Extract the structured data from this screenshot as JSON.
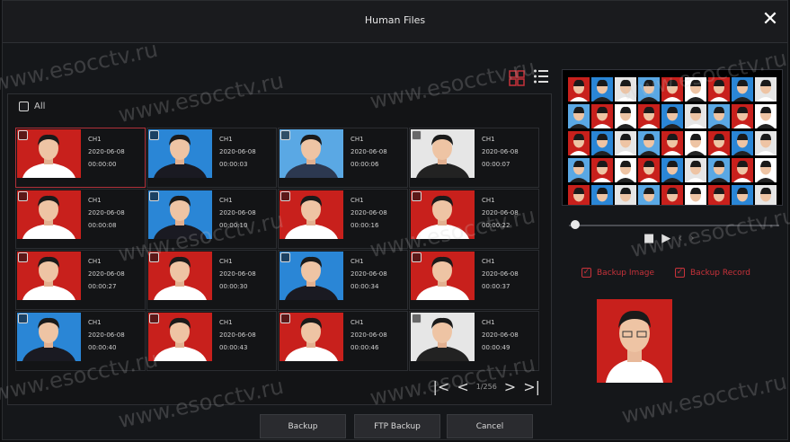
{
  "window": {
    "title": "Human Files",
    "close_label": "✕"
  },
  "select_all": {
    "label": "All",
    "checked": false
  },
  "files": [
    {
      "channel": "CH1",
      "date": "2020-06-08",
      "time": "00:00:00",
      "bg": "#c8201c",
      "shirt": "#ffffff",
      "selected": true
    },
    {
      "channel": "CH1",
      "date": "2020-06-08",
      "time": "00:00:03",
      "bg": "#2a86d6",
      "shirt": "#1a1a22",
      "selected": false
    },
    {
      "channel": "CH1",
      "date": "2020-06-08",
      "time": "00:00:06",
      "bg": "#5aa8e4",
      "shirt": "#2c3850",
      "selected": false
    },
    {
      "channel": "CH1",
      "date": "2020-06-08",
      "time": "00:00:07",
      "bg": "#e6e6e6",
      "shirt": "#222222",
      "selected": false
    },
    {
      "channel": "CH1",
      "date": "2020-06-08",
      "time": "00:00:08",
      "bg": "#c8201c",
      "shirt": "#ffffff",
      "selected": false
    },
    {
      "channel": "CH1",
      "date": "2020-06-08",
      "time": "00:00:10",
      "bg": "#2a86d6",
      "shirt": "#1a1a22",
      "selected": false
    },
    {
      "channel": "CH1",
      "date": "2020-06-08",
      "time": "00:00:16",
      "bg": "#c8201c",
      "shirt": "#ffffff",
      "selected": false
    },
    {
      "channel": "CH1",
      "date": "2020-06-08",
      "time": "00:00:22",
      "bg": "#c8201c",
      "shirt": "#ffffff",
      "selected": false
    },
    {
      "channel": "CH1",
      "date": "2020-06-08",
      "time": "00:00:27",
      "bg": "#c8201c",
      "shirt": "#ffffff",
      "selected": false
    },
    {
      "channel": "CH1",
      "date": "2020-06-08",
      "time": "00:00:30",
      "bg": "#c8201c",
      "shirt": "#ffffff",
      "selected": false
    },
    {
      "channel": "CH1",
      "date": "2020-06-08",
      "time": "00:00:34",
      "bg": "#2a86d6",
      "shirt": "#1a1a22",
      "selected": false
    },
    {
      "channel": "CH1",
      "date": "2020-06-08",
      "time": "00:00:37",
      "bg": "#c8201c",
      "shirt": "#ffffff",
      "selected": false
    },
    {
      "channel": "CH1",
      "date": "2020-06-08",
      "time": "00:00:40",
      "bg": "#2a86d6",
      "shirt": "#1a1a22",
      "selected": false
    },
    {
      "channel": "CH1",
      "date": "2020-06-08",
      "time": "00:00:43",
      "bg": "#c8201c",
      "shirt": "#ffffff",
      "selected": false
    },
    {
      "channel": "CH1",
      "date": "2020-06-08",
      "time": "00:00:46",
      "bg": "#c8201c",
      "shirt": "#ffffff",
      "selected": false
    },
    {
      "channel": "CH1",
      "date": "2020-06-08",
      "time": "00:00:49",
      "bg": "#e6e6e6",
      "shirt": "#222222",
      "selected": false
    }
  ],
  "pagination": {
    "first": "|<",
    "prev": "<",
    "page": "1/256",
    "next": ">",
    "last": ">|"
  },
  "view_icons": {
    "grid": "grid-view-icon",
    "list": "list-view-icon",
    "accent": "#c8323a"
  },
  "playback": {
    "progress": 0.0
  },
  "backup_options": [
    {
      "label": "Backup Image",
      "checked": true
    },
    {
      "label": "Backup Record",
      "checked": true
    }
  ],
  "buttons": {
    "backup": "Backup",
    "ftp_backup": "FTP Backup",
    "cancel": "Cancel"
  },
  "watermark": "www.esocctv.ru"
}
